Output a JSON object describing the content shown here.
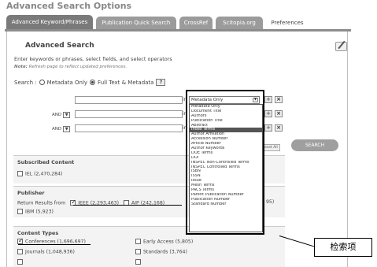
{
  "page": {
    "title": "Advanced Search Options"
  },
  "tabs": [
    {
      "label": "Advanced Keyword/Phrases"
    },
    {
      "label": "Publication Quick Search"
    },
    {
      "label": "CrossRef"
    },
    {
      "label": "Scitopia.org"
    },
    {
      "label": "Preferences"
    }
  ],
  "form": {
    "heading": "Advanced Search",
    "intro": "Enter keywords or phrases, select fields, and select operators",
    "note_label": "Note:",
    "note_text": "Refresh page to reflect updated preferences.",
    "search_label": "Search :",
    "scope_metadata": "Metadata Only",
    "scope_fulltext": "Full Text & Metadata",
    "help_label": "?",
    "in_label": "in",
    "operators": [
      "AND",
      "AND"
    ],
    "field_selected": "Metadata Only",
    "field_options": [
      "Metadata Only",
      "Document Title",
      "Authors",
      "Publication Title",
      "Abstract",
      "Index Terms",
      "Author Affiliation",
      "Accession Number",
      "Article Number",
      "Author Keywords",
      "DOE Terms",
      "DOI",
      "INSPEC Non-Controlled Terms",
      "INSPEC Controlled Terms",
      "ISBN",
      "ISSN",
      "Issue",
      "Mesh Terms",
      "PACS Terms",
      "Parent Publication Number",
      "Publication Number",
      "Standard Number"
    ],
    "highlighted_option": "Index Terms",
    "reset_label": "Reset All",
    "search_button": "SEARCH",
    "add_symbol": "+",
    "remove_symbol": "×"
  },
  "subscribed": {
    "title": "Subscribed Content",
    "item": "IEL (2,470,284)"
  },
  "publisher": {
    "title": "Publisher",
    "return_label": "Return Results from",
    "items": [
      "IEEE (2,293,463)",
      "AIP (242,168)",
      "IBM (5,923)"
    ],
    "partial_count": "95)"
  },
  "content_types": {
    "title": "Content Types",
    "col1": [
      "Conferences (1,696,697)",
      "Journals (1,048,936)",
      ""
    ],
    "col2": [
      "Early Access (5,805)",
      "Standards (3,764)",
      ""
    ]
  },
  "annotation": {
    "label": "检索项"
  }
}
